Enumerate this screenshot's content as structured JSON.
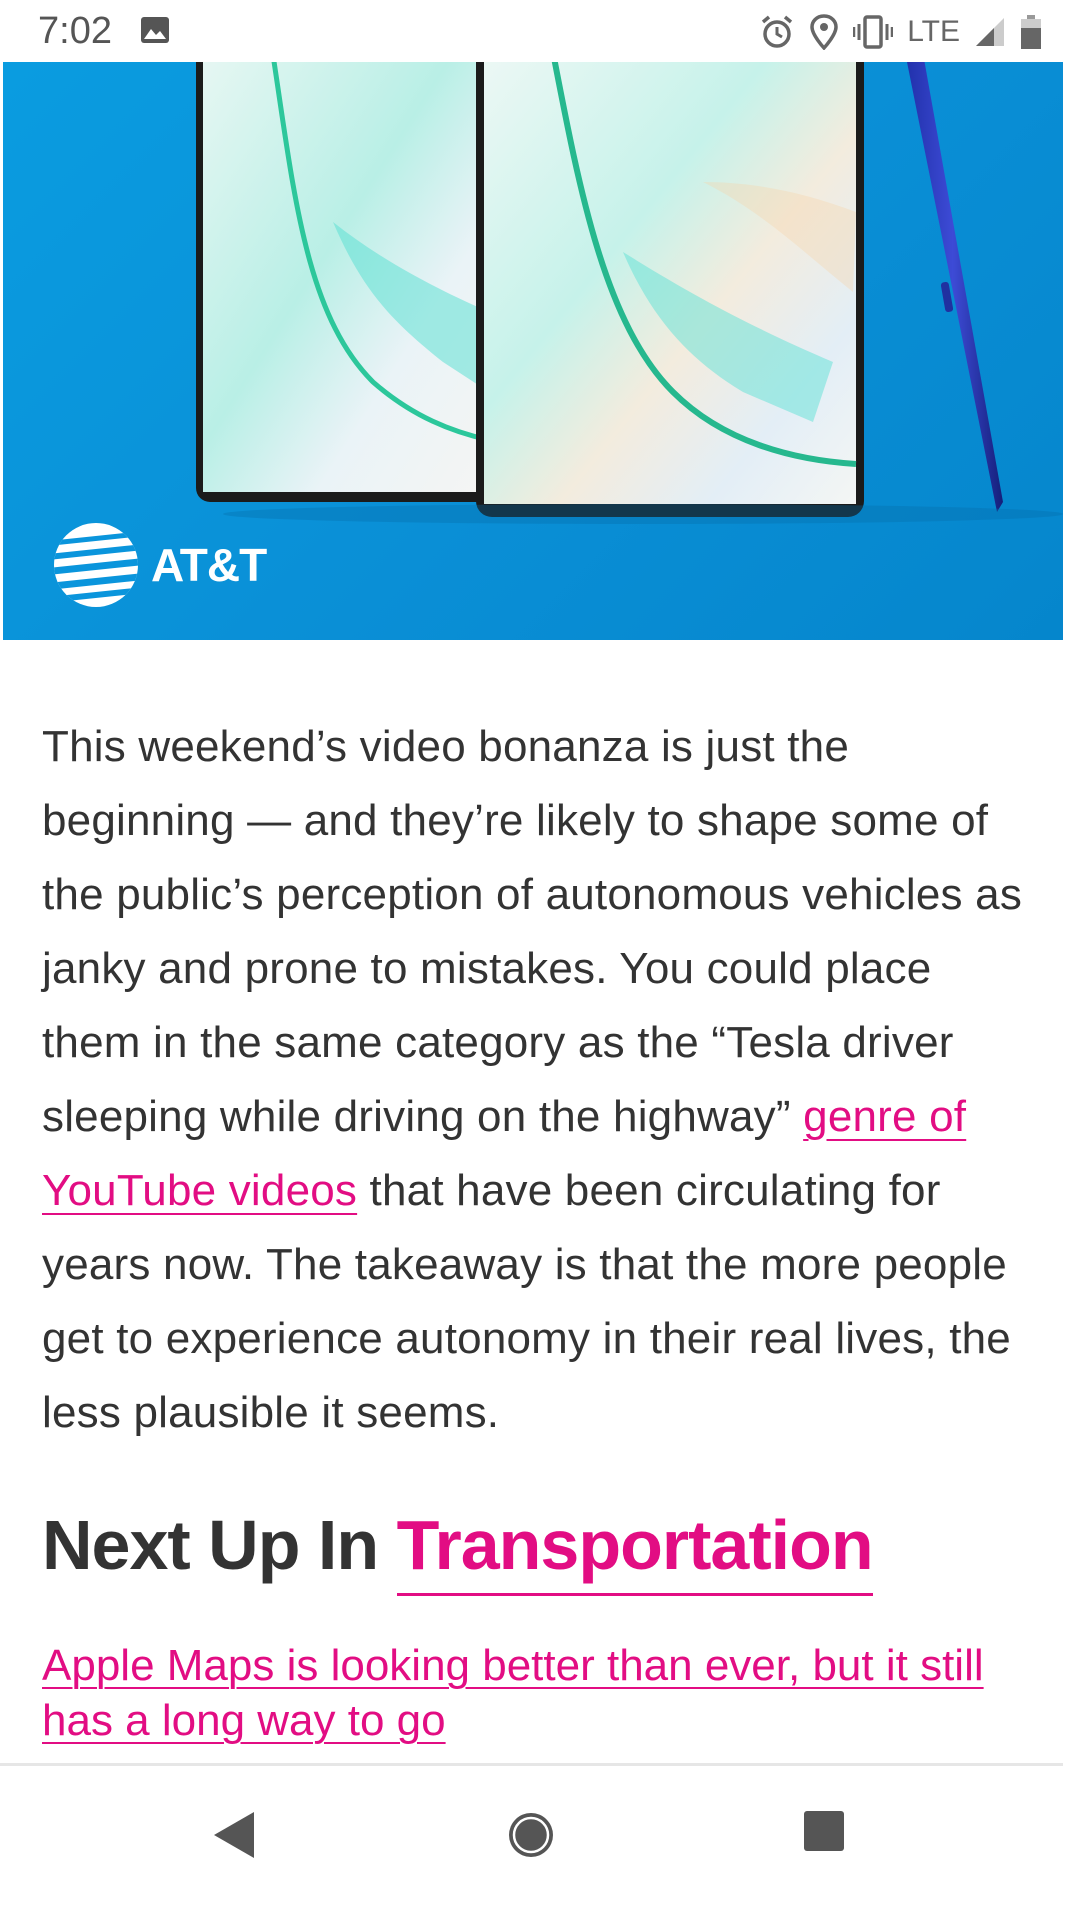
{
  "status_bar": {
    "time": "7:02",
    "network": "LTE",
    "icons": [
      "image-icon",
      "alarm-icon",
      "location-icon",
      "vibrate-icon",
      "signal-icon",
      "battery-icon"
    ]
  },
  "hero": {
    "brand": "AT&T",
    "background_color": "#0a9ce0"
  },
  "article": {
    "paragraph_before_link": "This weekend’s video bonanza is just the beginning — and they’re likely to shape some of the public’s perception of autonomous vehicles as janky and prone to mistakes. You could place them in the same category as the “Tesla driver sleeping while driving on the highway”",
    "link_text": "genre of YouTube videos",
    "paragraph_after_link": " that have been circulating for years now. The takeaway is that the more people get to experience autonomy in their real lives, the less plausible it seems."
  },
  "next_up": {
    "prefix": "Next Up In ",
    "category": "Transportation",
    "article_title": "Apple Maps is looking better than ever, but it still has a long way to go"
  },
  "colors": {
    "accent": "#e20d83",
    "text": "#333333"
  },
  "nav": {
    "buttons": [
      "back-icon",
      "home-icon",
      "recents-icon"
    ]
  }
}
